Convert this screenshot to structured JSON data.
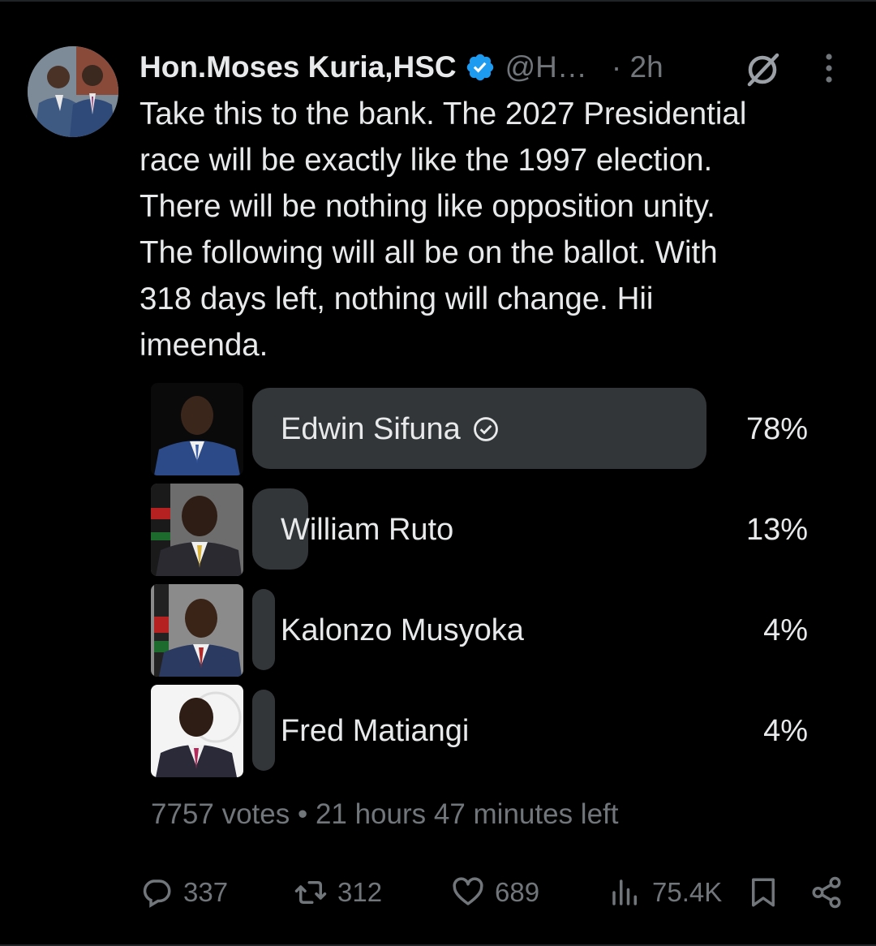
{
  "author": {
    "display_name": "Hon.Moses Kuria,HSC",
    "handle": "@H…",
    "time": "· 2h"
  },
  "tweet_text": "Take this to the bank. The 2027 Presidential\nrace will be exactly like the 1997 election.\nThere will be nothing like opposition unity.\nThe following will all be on the ballot. With\n318 days left, nothing will change. Hii\nimeenda.",
  "poll": {
    "options": [
      {
        "label": "Edwin Sifuna",
        "percent_text": "78%",
        "percent": 78,
        "selected": true
      },
      {
        "label": "William Ruto",
        "percent_text": "13%",
        "percent": 13,
        "selected": false
      },
      {
        "label": "Kalonzo Musyoka",
        "percent_text": "4%",
        "percent": 4,
        "selected": false
      },
      {
        "label": "Fred Matiangi",
        "percent_text": "4%",
        "percent": 4,
        "selected": false
      }
    ],
    "meta": "7757 votes • 21 hours 47 minutes left"
  },
  "actions": {
    "replies": "337",
    "reposts": "312",
    "likes": "689",
    "views": "75.4K"
  },
  "colors": {
    "background": "#000000",
    "text": "#e7e9ea",
    "muted": "#71767b",
    "poll_bar": "#333639",
    "verified": "#1d9bf0"
  }
}
